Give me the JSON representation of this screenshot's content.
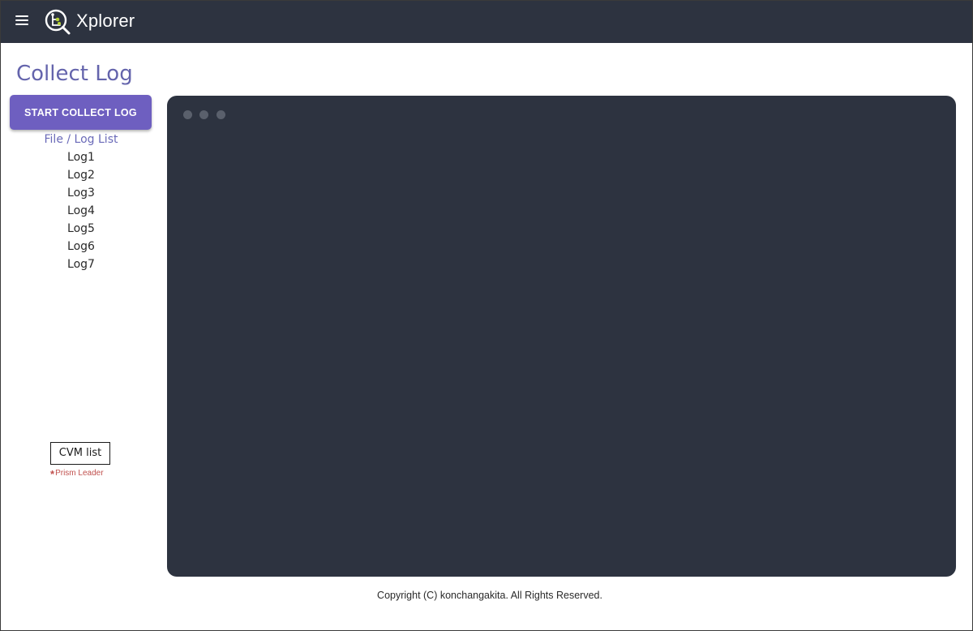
{
  "header": {
    "brand": "Xplorer",
    "menu_icon": "hamburger-menu-icon",
    "logo_icon": "xplorer-magnifier-logo-icon"
  },
  "page": {
    "title": "Collect Log"
  },
  "actions": {
    "start_label": "START COLLECT LOG"
  },
  "sidebar": {
    "list_heading": "File / Log List",
    "logs": [
      "Log1",
      "Log2",
      "Log3",
      "Log4",
      "Log5",
      "Log6",
      "Log7"
    ],
    "cvm_label": "CVM list",
    "prism_asterisk": "*",
    "prism_note": "Prism Leader"
  },
  "terminal": {
    "window_dots": [
      "window-dot-icon",
      "window-dot-icon",
      "window-dot-icon"
    ]
  },
  "footer": {
    "copyright": "Copyright (C) konchangakita. All Rights Reserved."
  },
  "colors": {
    "header_bg": "#2d3340",
    "accent": "#6e5fc0",
    "title": "#6464ac",
    "terminal_bg": "#2d3340",
    "note_red": "#c0504d"
  }
}
